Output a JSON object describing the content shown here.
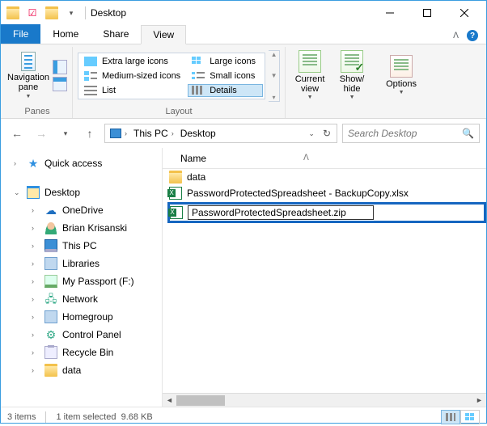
{
  "window": {
    "title": "Desktop"
  },
  "tabs": {
    "file": "File",
    "home": "Home",
    "share": "Share",
    "view": "View"
  },
  "ribbon": {
    "panes_label": "Panes",
    "layout_label": "Layout",
    "navpane": "Navigation\npane",
    "layout_opts": {
      "xl": "Extra large icons",
      "lg": "Large icons",
      "med": "Medium-sized icons",
      "sm": "Small icons",
      "list": "List",
      "details": "Details"
    },
    "current_view": "Current\nview",
    "show_hide": "Show/\nhide",
    "options": "Options"
  },
  "address": {
    "crumbs": [
      "This PC",
      "Desktop"
    ],
    "search_placeholder": "Search Desktop"
  },
  "tree": {
    "quick": "Quick access",
    "desktop": "Desktop",
    "items": [
      {
        "icon": "onedrive",
        "label": "OneDrive"
      },
      {
        "icon": "user",
        "label": "Brian Krisanski"
      },
      {
        "icon": "monitor",
        "label": "This PC"
      },
      {
        "icon": "lib",
        "label": "Libraries"
      },
      {
        "icon": "drive",
        "label": "My Passport (F:)"
      },
      {
        "icon": "net",
        "label": "Network"
      },
      {
        "icon": "home",
        "label": "Homegroup"
      },
      {
        "icon": "ctrl",
        "label": "Control Panel"
      },
      {
        "icon": "bin",
        "label": "Recycle Bin"
      },
      {
        "icon": "folder",
        "label": "data"
      }
    ]
  },
  "files": {
    "col_name": "Name",
    "rows": [
      {
        "icon": "folder",
        "name": "data"
      },
      {
        "icon": "xls",
        "name": "PasswordProtectedSpreadsheet - BackupCopy.xlsx"
      },
      {
        "icon": "xls",
        "name": "PasswordProtectedSpreadsheet.zip",
        "editing": true
      }
    ]
  },
  "status": {
    "count": "3 items",
    "selection": "1 item selected",
    "size": "9.68 KB"
  }
}
